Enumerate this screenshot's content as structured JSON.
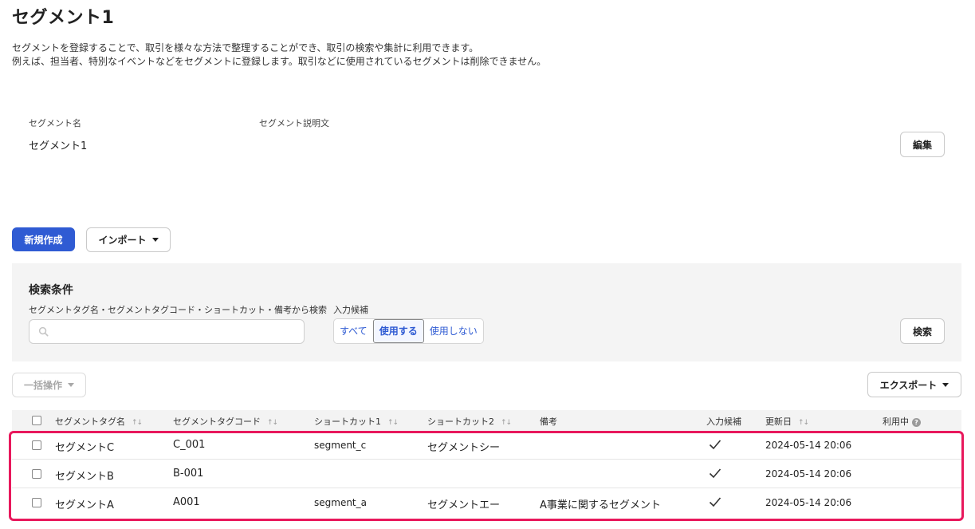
{
  "page": {
    "title": "セグメント1",
    "description_line1": "セグメントを登録することで、取引を様々な方法で整理することができ、取引の検索や集計に利用できます。",
    "description_line2": "例えば、担当者、特別なイベントなどをセグメントに登録します。取引などに使用されているセグメントは削除できません。"
  },
  "segment_info": {
    "name_label": "セグメント名",
    "name_value": "セグメント1",
    "desc_label": "セグメント説明文",
    "desc_value": "",
    "edit_button": "編集"
  },
  "toolbar": {
    "new_button": "新規作成",
    "import_button": "インポート"
  },
  "search": {
    "title": "検索条件",
    "keyword_label": "セグメントタグ名・セグメントタグコード・ショートカット・備考から検索",
    "keyword_value": "",
    "candidate_label": "入力候補",
    "options": [
      "すべて",
      "使用する",
      "使用しない"
    ],
    "selected_option": "使用する",
    "search_button": "検索"
  },
  "actions": {
    "bulk_button": "一括操作",
    "export_button": "エクスポート"
  },
  "table": {
    "columns": {
      "name": "セグメントタグ名",
      "code": "セグメントタグコード",
      "shortcut1": "ショートカット1",
      "shortcut2": "ショートカット2",
      "note": "備考",
      "candidate": "入力候補",
      "updated": "更新日",
      "in_use": "利用中"
    },
    "rows": [
      {
        "name": "セグメントC",
        "code": "C_001",
        "shortcut1": "segment_c",
        "shortcut2": "セグメントシー",
        "note": "",
        "candidate": true,
        "updated": "2024-05-14 20:06",
        "in_use": ""
      },
      {
        "name": "セグメントB",
        "code": "B-001",
        "shortcut1": "",
        "shortcut2": "",
        "note": "",
        "candidate": true,
        "updated": "2024-05-14 20:06",
        "in_use": ""
      },
      {
        "name": "セグメントA",
        "code": "A001",
        "shortcut1": "segment_a",
        "shortcut2": "セグメントエー",
        "note": "A事業に関するセグメント",
        "candidate": true,
        "updated": "2024-05-14 20:06",
        "in_use": ""
      }
    ]
  },
  "colors": {
    "primary": "#2f5bd3",
    "highlight": "#e8185c",
    "panel_bg": "#f4f4f4"
  }
}
